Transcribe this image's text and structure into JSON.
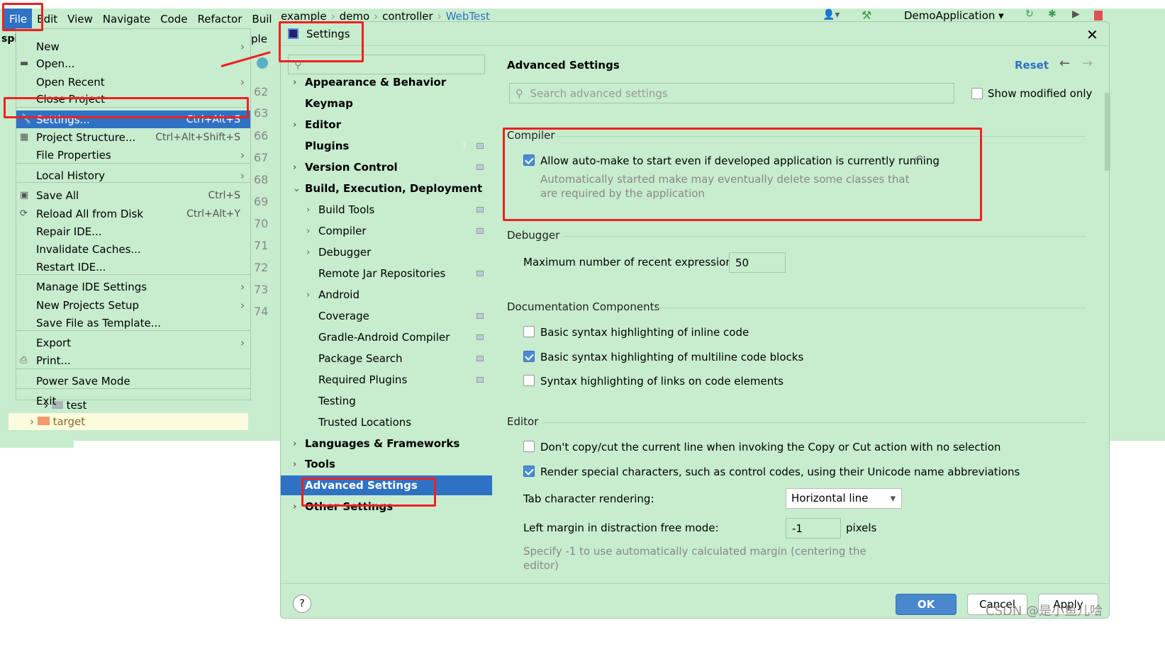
{
  "menubar": {
    "items": [
      "File",
      "Edit",
      "View",
      "Navigate",
      "Code",
      "Refactor",
      "Buil"
    ]
  },
  "breadcrumb": [
    "example",
    "demo",
    "controller",
    "WebTest"
  ],
  "toolbar": {
    "run_config": "DemoApplication"
  },
  "project_label": "spi",
  "tab_partial": "ple",
  "file_menu": {
    "items": [
      {
        "label": "New",
        "shortcut": "",
        "submenu": true
      },
      {
        "label": "Open...",
        "shortcut": "",
        "icon": "folder-icon"
      },
      {
        "label": "Open Recent",
        "shortcut": "",
        "submenu": true
      },
      {
        "label": "Close Project",
        "shortcut": ""
      },
      {
        "label": "Settings...",
        "shortcut": "Ctrl+Alt+S",
        "icon": "wrench-icon",
        "selected": true
      },
      {
        "label": "Project Structure...",
        "shortcut": "Ctrl+Alt+Shift+S",
        "icon": "project-structure-icon"
      },
      {
        "label": "File Properties",
        "shortcut": "",
        "submenu": true
      },
      {
        "label": "Local History",
        "shortcut": "",
        "submenu": true
      },
      {
        "label": "Save All",
        "shortcut": "Ctrl+S",
        "icon": "save-icon"
      },
      {
        "label": "Reload All from Disk",
        "shortcut": "Ctrl+Alt+Y",
        "icon": "reload-icon"
      },
      {
        "label": "Repair IDE...",
        "shortcut": ""
      },
      {
        "label": "Invalidate Caches...",
        "shortcut": ""
      },
      {
        "label": "Restart IDE...",
        "shortcut": ""
      },
      {
        "label": "Manage IDE Settings",
        "shortcut": "",
        "submenu": true
      },
      {
        "label": "New Projects Setup",
        "shortcut": "",
        "submenu": true
      },
      {
        "label": "Save File as Template...",
        "shortcut": ""
      },
      {
        "label": "Export",
        "shortcut": "",
        "submenu": true
      },
      {
        "label": "Print...",
        "shortcut": "",
        "icon": "print-icon"
      },
      {
        "label": "Power Save Mode",
        "shortcut": ""
      },
      {
        "label": "Exit",
        "shortcut": ""
      }
    ]
  },
  "project_tree": [
    "test",
    "target"
  ],
  "line_numbers": [
    "62",
    "63",
    "66",
    "67",
    "68",
    "69",
    "70",
    "71",
    "72",
    "73",
    "74"
  ],
  "dialog": {
    "title": "Settings",
    "tree": [
      {
        "label": "Appearance & Behavior",
        "bold": true,
        "chev": true,
        "level": 0
      },
      {
        "label": "Keymap",
        "bold": true,
        "level": 0
      },
      {
        "label": "Editor",
        "bold": true,
        "chev": true,
        "level": 0
      },
      {
        "label": "Plugins",
        "bold": true,
        "level": 0,
        "badge": "3",
        "page": true
      },
      {
        "label": "Version Control",
        "bold": true,
        "chev": true,
        "level": 0,
        "page": true
      },
      {
        "label": "Build, Execution, Deployment",
        "bold": true,
        "chev": true,
        "open": true,
        "level": 0
      },
      {
        "label": "Build Tools",
        "chev": true,
        "level": 1,
        "page": true
      },
      {
        "label": "Compiler",
        "chev": true,
        "level": 1,
        "page": true
      },
      {
        "label": "Debugger",
        "chev": true,
        "level": 1
      },
      {
        "label": "Remote Jar Repositories",
        "level": 1,
        "page": true
      },
      {
        "label": "Android",
        "chev": true,
        "level": 1
      },
      {
        "label": "Coverage",
        "level": 1,
        "page": true
      },
      {
        "label": "Gradle-Android Compiler",
        "level": 1,
        "page": true
      },
      {
        "label": "Package Search",
        "level": 1,
        "page": true
      },
      {
        "label": "Required Plugins",
        "level": 1,
        "page": true
      },
      {
        "label": "Testing",
        "level": 1
      },
      {
        "label": "Trusted Locations",
        "level": 1
      },
      {
        "label": "Languages & Frameworks",
        "bold": true,
        "chev": true,
        "level": 0
      },
      {
        "label": "Tools",
        "bold": true,
        "chev": true,
        "level": 0
      },
      {
        "label": "Advanced Settings",
        "bold": true,
        "level": 0,
        "selected": true
      },
      {
        "label": "Other Settings",
        "bold": true,
        "chev": true,
        "level": 0
      }
    ],
    "header": "Advanced Settings",
    "reset": "Reset",
    "search_placeholder": "Search advanced settings",
    "show_modified": "Show modified only",
    "compiler": {
      "title": "Compiler",
      "option": "Allow auto-make to start even if developed application is currently running",
      "checked": true,
      "hint1": "Automatically started make may eventually delete some classes that",
      "hint2": "are required by the application"
    },
    "debugger": {
      "title": "Debugger",
      "label": "Maximum number of recent expressions:",
      "value": "50"
    },
    "docs": {
      "title": "Documentation Components",
      "options": [
        {
          "label": "Basic syntax highlighting of inline code",
          "checked": false
        },
        {
          "label": "Basic syntax highlighting of multiline code blocks",
          "checked": true
        },
        {
          "label": "Syntax highlighting of links on code elements",
          "checked": false
        }
      ]
    },
    "editor": {
      "title": "Editor",
      "options": [
        {
          "label": "Don't copy/cut the current line when invoking the Copy or Cut action with no selection",
          "checked": false
        },
        {
          "label": "Render special characters, such as control codes, using their Unicode name abbreviations",
          "checked": true
        }
      ],
      "tab_label": "Tab character rendering:",
      "tab_value": "Horizontal line",
      "margin_label": "Left margin in distraction free mode:",
      "margin_value": "-1",
      "margin_unit": "pixels",
      "margin_hint1": "Specify -1 to use automatically calculated margin (centering the",
      "margin_hint2": "editor)"
    },
    "buttons": {
      "ok": "OK",
      "cancel": "Cancel",
      "apply": "Apply",
      "help": "?"
    }
  },
  "watermark": "CSDN @是小鱼儿哈",
  "colors": {
    "background": "#c7ecce",
    "accent": "#2f72c4",
    "highlight": "#f02020"
  }
}
